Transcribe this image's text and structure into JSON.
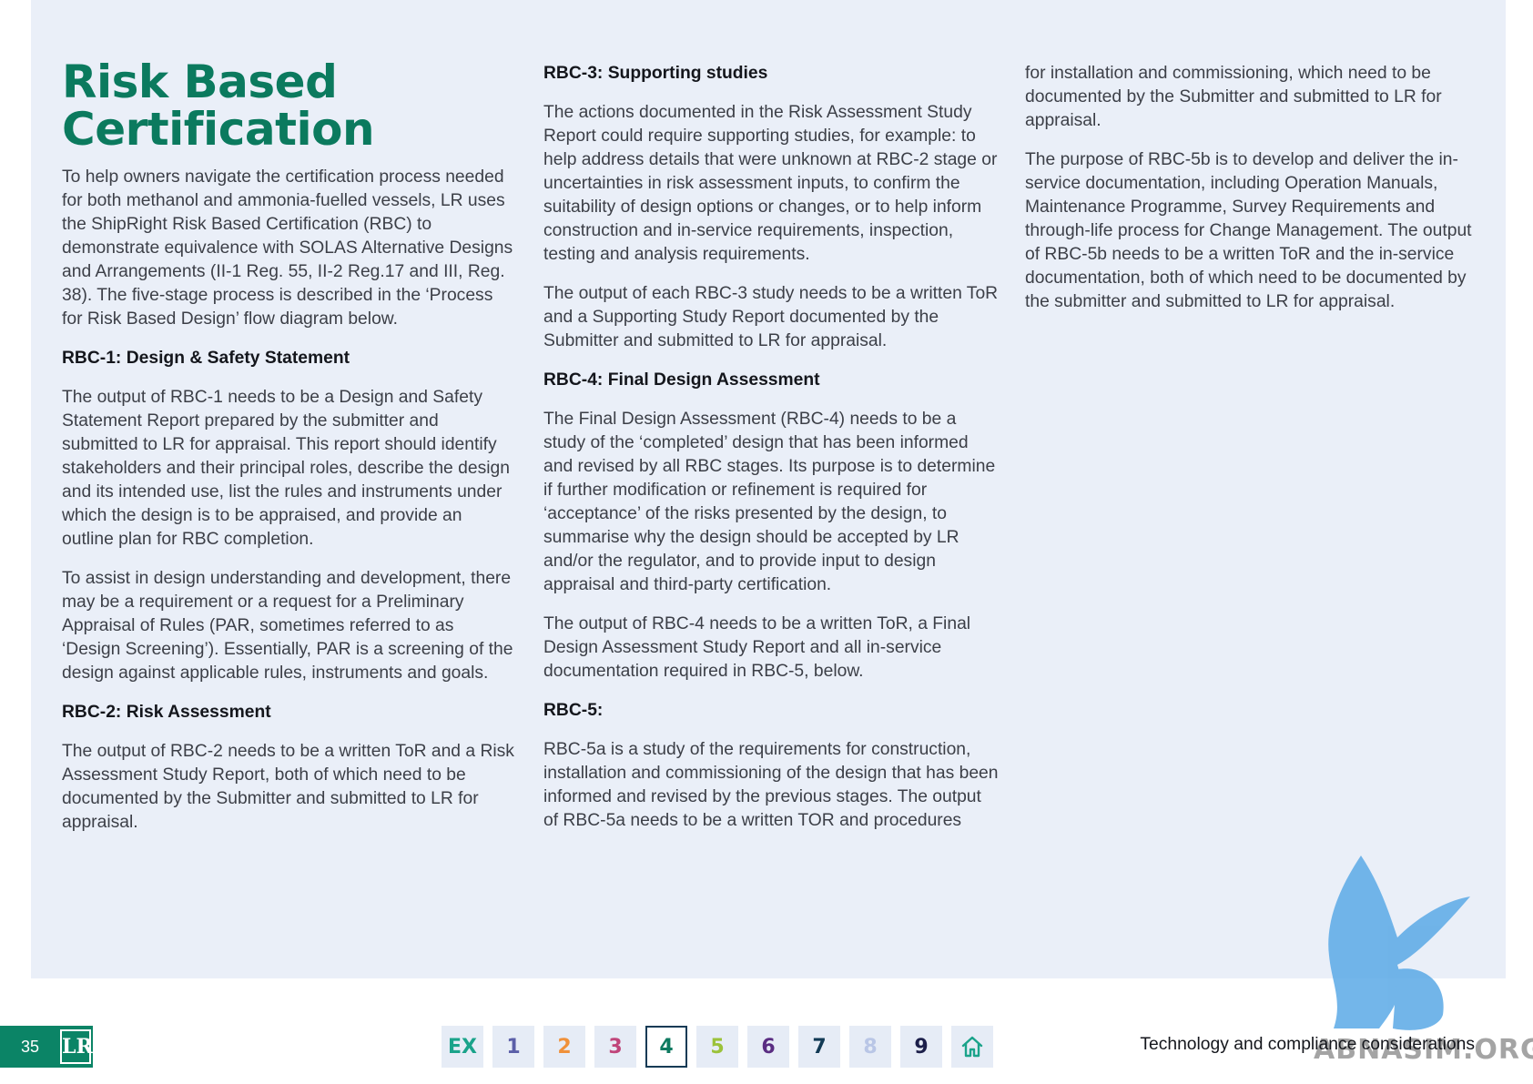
{
  "title": "Risk Based Certification",
  "col1": {
    "intro": "To help owners navigate the certification process needed for both methanol and ammonia-fuelled vessels, LR uses the ShipRight Risk Based Certification (RBC) to demonstrate equivalence with SOLAS Alternative Designs and Arrangements (II-1 Reg. 55, II-2 Reg.17 and III, Reg. 38). The five-stage process is described in the ‘Process for Risk Based Design’ flow diagram below.",
    "rbc1_heading": "RBC-1: Design & Safety Statement",
    "rbc1_p1": "The output of RBC-1 needs to be a Design and Safety Statement Report prepared by the submitter and submitted to LR for appraisal. This report should identify stakeholders and their principal roles, describe the design and its intended use, list the rules and instruments under which the design is to be appraised, and provide an outline plan for RBC completion.",
    "rbc1_p2": "To assist in design understanding and development, there may be a requirement or a request for a Preliminary Appraisal of Rules (PAR, sometimes referred to as ‘Design Screening’). Essentially, PAR is a screening of the design against applicable rules, instruments and goals.",
    "rbc2_heading": "RBC-2: Risk Assessment",
    "rbc2_p1": "The output of RBC-2 needs to be a written ToR and a Risk Assessment Study Report, both of which need to be documented by the Submitter and submitted to LR for appraisal."
  },
  "col2": {
    "rbc3_heading": "RBC-3: Supporting studies",
    "rbc3_p1": "The actions documented in the Risk Assessment Study Report could require supporting studies, for example: to help address details that were unknown at RBC-2 stage or uncertainties in risk assessment inputs, to confirm the suitability of design options or changes, or to help inform construction and in-service requirements, inspection, testing and analysis requirements.",
    "rbc3_p2": "The output of each RBC-3 study needs to be a written ToR and a Supporting Study Report documented by the Submitter and submitted to LR for appraisal.",
    "rbc4_heading": "RBC-4: Final Design Assessment",
    "rbc4_p1": "The Final Design Assessment (RBC-4) needs to be a study of the ‘completed’ design that has been informed and revised by all RBC stages. Its purpose is to determine if further modification or refinement is required for ‘acceptance’ of the risks presented by the design, to summarise why the design should be accepted by LR and/or the regulator, and to provide input to design appraisal and third-party certification.",
    "rbc4_p2": "The output of RBC-4 needs to be a written ToR, a Final Design Assessment Study Report and all in-service documentation required in RBC-5, below.",
    "rbc5_heading": "RBC-5:",
    "rbc5_p1": "RBC-5a is a study of the requirements for construction, installation and commissioning of the design that has been informed and revised by the previous stages. The output of RBC-5a needs to be a written TOR and procedures"
  },
  "col3": {
    "p1": "for installation and commissioning, which need to be documented by the Submitter and submitted to LR for appraisal.",
    "p2": "The purpose of RBC-5b is to develop and deliver the in-service documentation, including Operation Manuals, Maintenance Programme, Survey Requirements and through-life process for Change Management. The output of RBC-5b needs to be a written ToR and the in-service documentation, both of which need to be documented by the submitter and submitted to LR for appraisal."
  },
  "footer": {
    "page_number": "35",
    "logo_text": "LR",
    "nav": [
      {
        "label": "EX",
        "color": "#1aa38a",
        "active": false
      },
      {
        "label": "1",
        "color": "#5b5fa8",
        "active": false
      },
      {
        "label": "2",
        "color": "#f0913a",
        "active": false
      },
      {
        "label": "3",
        "color": "#c0457a",
        "active": false
      },
      {
        "label": "4",
        "color": "#0f7a60",
        "active": true
      },
      {
        "label": "5",
        "color": "#9bc23a",
        "active": false
      },
      {
        "label": "6",
        "color": "#5a2d82",
        "active": false
      },
      {
        "label": "7",
        "color": "#123a55",
        "active": false
      },
      {
        "label": "8",
        "color": "#b9c6e6",
        "active": false
      },
      {
        "label": "9",
        "color": "#1c1f4a",
        "active": false
      }
    ],
    "home_icon": "home-icon",
    "section_title": "Technology and compliance considerations"
  },
  "watermark": {
    "text": "ABNASIM.ORG",
    "color": "#5aa9e6"
  }
}
